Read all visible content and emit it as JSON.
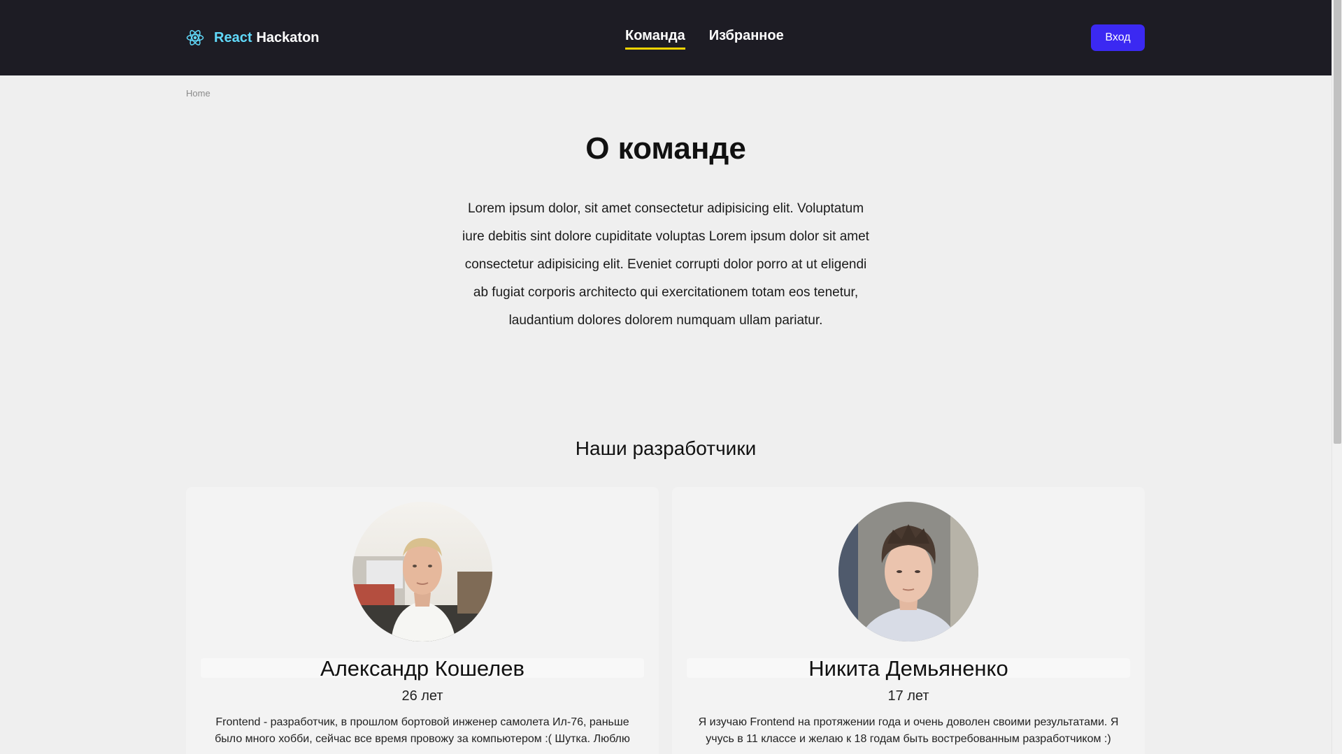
{
  "header": {
    "logo_react": "React",
    "logo_name": "Hackaton",
    "nav": {
      "team": "Команда",
      "favorites": "Избранное"
    },
    "login_label": "Вход",
    "colors": {
      "background": "#1d1c24",
      "react_accent": "#61dafb",
      "active_underline": "#f5d400",
      "login_button": "#3b29f2"
    }
  },
  "breadcrumb": {
    "home": "Home"
  },
  "intro": {
    "title": "О команде",
    "text": "Lorem ipsum dolor, sit amet consectetur adipisicing elit. Voluptatum iure debitis sint dolore cupiditate voluptas Lorem ipsum dolor sit amet consectetur adipisicing elit. Eveniet corrupti dolor porro at ut eligendi ab fugiat corporis architecto qui exercitationem totam eos tenetur, laudantium dolores dolorem numquam ullam pariatur."
  },
  "developers": {
    "title": "Наши разработчики",
    "items": [
      {
        "name": "Александр Кошелев",
        "age": "26 лет",
        "bio": "Frontend - разработчик, в прошлом бортовой инженер самолета Ил-76, раньше было много хобби, сейчас все время провожу за компьютером :( Шутка. Люблю"
      },
      {
        "name": "Никита Демьяненко",
        "age": "17 лет",
        "bio": "Я изучаю Frontend на протяжении года и очень доволен своими результатами. Я учусь в 11 классе и желаю к 18 годам быть востребованным разработчиком :)"
      }
    ]
  },
  "icons": {
    "logo": "react-atom-icon",
    "avatar_1": "developer-photo",
    "avatar_2": "developer-photo"
  }
}
